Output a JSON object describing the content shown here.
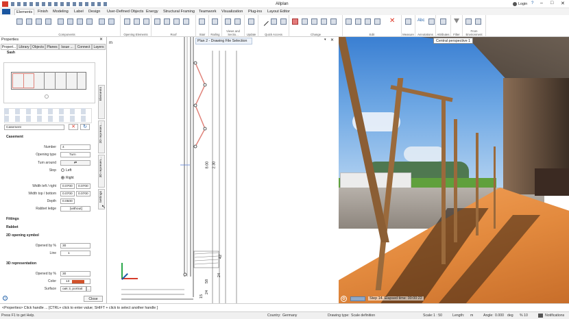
{
  "app": {
    "title": "Allplan"
  },
  "titlebar": {
    "login": "Login"
  },
  "menu": {
    "tabs": [
      "Elements",
      "Finish",
      "Modeling",
      "Label",
      "Design",
      "User-Defined Objects",
      "Energy",
      "Structural Framing",
      "Teamwork",
      "Visualization",
      "Plug-ins",
      "Layout Editor"
    ]
  },
  "ribbon": {
    "groups": [
      "Components",
      "Opening Elements",
      "Roof",
      "Stair",
      "Railing",
      "Views and Sectio...",
      "Update",
      "Quick Access",
      "Change",
      "Edit",
      "Measure",
      "Annotations",
      "Attributes",
      "Filter",
      "From Environment"
    ]
  },
  "properties": {
    "title": "Properties",
    "tabs": [
      "Propert...",
      "Library",
      "Objects",
      "Planes",
      "Issue ...",
      "Connect",
      "Layers"
    ],
    "section_top": "Sash",
    "type_value": "Casement",
    "casement_header": "Casement",
    "fields": {
      "number_label": "Number",
      "number_value": "4",
      "opening_type_label": "Opening type",
      "opening_type_value": "Turn",
      "turn_around_label": "Turn around",
      "stop_label": "Stop",
      "stop_left": "Left",
      "stop_right": "Right",
      "width_lr_label": "Width left / right",
      "width_l": "0.0700",
      "width_r": "0.0700",
      "width_tb_label": "Width top / bottom",
      "width_t": "0.0700",
      "width_b": "0.0700",
      "depth_label": "Depth",
      "depth_value": "0.0500",
      "rabbet_label": "Rabbet ledge",
      "rabbet_value": "[without]"
    },
    "fittings": "Fittings",
    "rabbet": "Rabbet",
    "opening2d": "2D opening symbol",
    "opened_by_label": "Opened by %",
    "opened_by_value": "30",
    "line_label": "Line",
    "line_value": "1",
    "rep3d": "3D representation",
    "opened_by3d_value": "30",
    "color_label": "Color",
    "color_value": "13",
    "surface_label": "Surface",
    "surface_value": "oak 3, portrait",
    "close": "Close",
    "vtabs": [
      "Elements",
      "2D represen...",
      "3D represen...",
      "Settings"
    ]
  },
  "drawing": {
    "tab_title": "Plan 2 - Drawing File Selection",
    "dims": [
      "8.00",
      "2.30",
      "42",
      "24",
      "58",
      "24",
      "15"
    ],
    "mark_m": "m"
  },
  "render": {
    "tooltip": "Central perspective 1",
    "step_text": "Step 14. Elapsed time: 00:00:22"
  },
  "cmdline": {
    "text": "<Properties> Click handle ... [CTRL+ click to enter value; SHIFT + click to select another handle ]"
  },
  "status": {
    "help": "Press F1 to get Help.",
    "country_label": "Country:",
    "country": "Germany",
    "drawing_type_label": "Drawing type:",
    "drawing_type": "Scale definition",
    "scale_label": "Scale:",
    "scale": "1 : 50",
    "length_label": "Length:",
    "length": "m",
    "angle_label": "Angle:",
    "angle": "0.000",
    "deg": "deg",
    "pct": "% 10",
    "notifications": "Notifications"
  },
  "colors": {
    "accent": "#1f5fa8",
    "sash": "#e0837a",
    "menuActive": "#1a56a0"
  }
}
